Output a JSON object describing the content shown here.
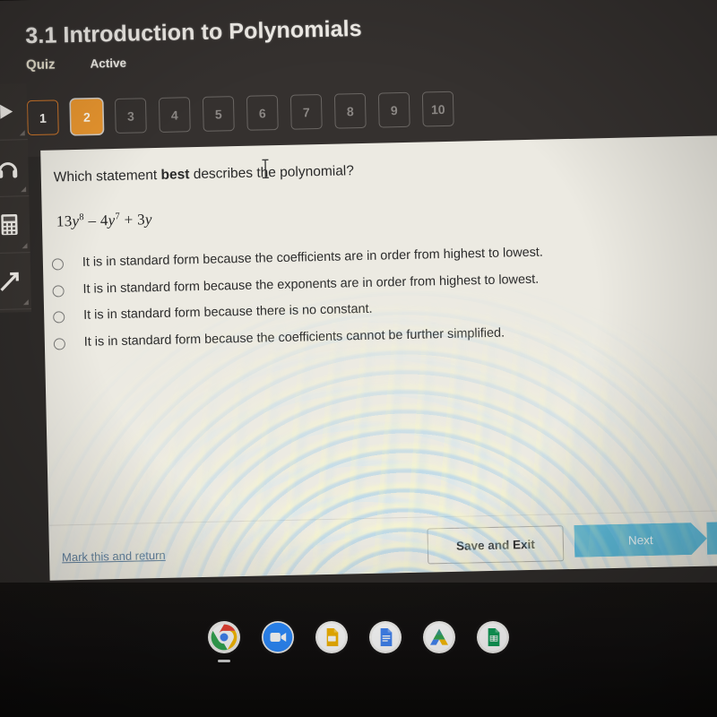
{
  "header": {
    "course_title": "3.1 Introduction to Polynomials",
    "assignment_type": "Quiz",
    "status": "Active",
    "accent_current": "#e9962f",
    "accent_done": "#d0772a"
  },
  "question_nav": {
    "items": [
      {
        "number": "1",
        "state": "done"
      },
      {
        "number": "2",
        "state": "current"
      },
      {
        "number": "3",
        "state": "locked"
      },
      {
        "number": "4",
        "state": "locked"
      },
      {
        "number": "5",
        "state": "locked"
      },
      {
        "number": "6",
        "state": "locked"
      },
      {
        "number": "7",
        "state": "locked"
      },
      {
        "number": "8",
        "state": "locked"
      },
      {
        "number": "9",
        "state": "locked"
      },
      {
        "number": "10",
        "state": "locked"
      }
    ]
  },
  "tool_rail": {
    "items": [
      {
        "icon": "expand-arrow-icon",
        "label": "Expand"
      },
      {
        "icon": "headphones-icon",
        "label": "Audio"
      },
      {
        "icon": "calculator-icon",
        "label": "Calculator"
      },
      {
        "icon": "line-tool-icon",
        "label": "Line tool"
      }
    ]
  },
  "question": {
    "prompt_pre": "Which statement ",
    "prompt_bold": "best",
    "prompt_post": " describes the polynomial?",
    "polynomial": {
      "term1_coef": "13",
      "term1_var": "y",
      "term1_exp": "8",
      "op1": "–",
      "term2_coef": "4",
      "term2_var": "y",
      "term2_exp": "7",
      "op2": "+",
      "term3_coef": "3",
      "term3_var": "y",
      "plain": "13y^8 – 4y^7 + 3y"
    },
    "options": [
      {
        "id": "a",
        "label": "It is in standard form because the coefficients are in order from highest to lowest.",
        "selected": false
      },
      {
        "id": "b",
        "label": "It is in standard form because the exponents are in order from highest to lowest.",
        "selected": false
      },
      {
        "id": "c",
        "label": "It is in standard form because there is no constant.",
        "selected": false
      },
      {
        "id": "d",
        "label": "It is in standard form because the coefficients cannot be further simplified.",
        "selected": false
      }
    ]
  },
  "footer": {
    "mark_link": "Mark this and return",
    "save_button": "Save and Exit",
    "next_button": "Next",
    "next_color": "#5cb9d8"
  },
  "shelf": {
    "icons": [
      {
        "name": "chrome-icon",
        "label": "Google Chrome",
        "active": true
      },
      {
        "name": "zoom-icon",
        "label": "Zoom",
        "active": false
      },
      {
        "name": "google-slides-icon",
        "label": "Google Slides",
        "active": false
      },
      {
        "name": "google-docs-icon",
        "label": "Google Docs",
        "active": false
      },
      {
        "name": "google-drive-icon",
        "label": "Google Drive",
        "active": false
      },
      {
        "name": "google-sheets-icon",
        "label": "Google Sheets",
        "active": false
      }
    ]
  }
}
